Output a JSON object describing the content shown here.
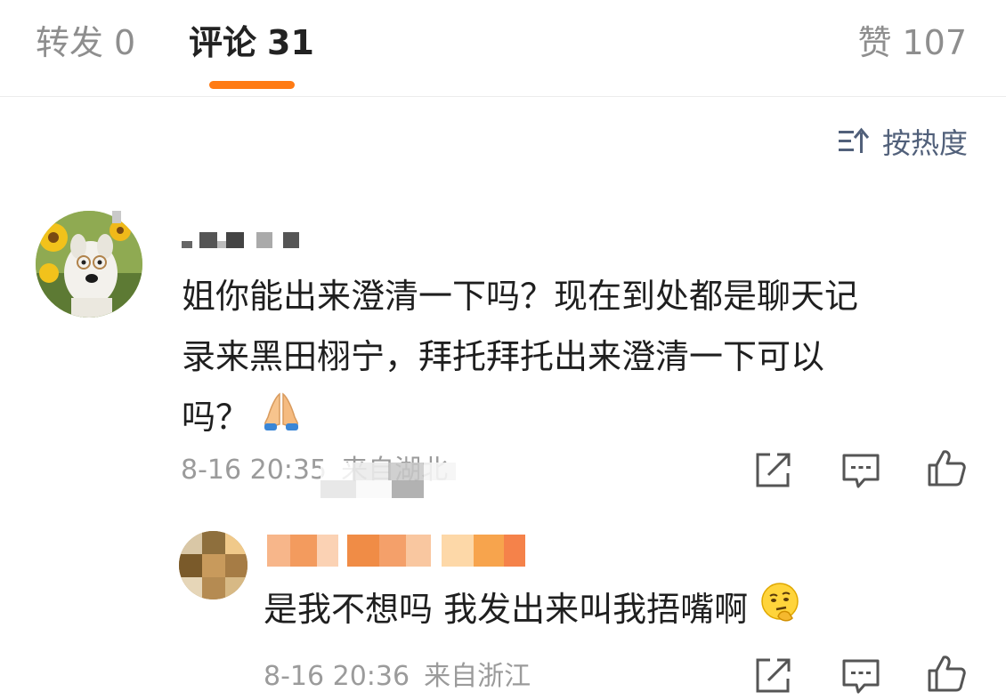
{
  "tabs": {
    "repost": {
      "label": "转发",
      "count": "0"
    },
    "comments": {
      "label": "评论",
      "count": "31"
    },
    "likes": {
      "label": "赞",
      "count": "107"
    }
  },
  "sort": {
    "label": "按热度",
    "icon": "sort-icon"
  },
  "colors": {
    "accent": "#ff7b14",
    "muted_text": "#9b9b9b",
    "sort_text": "#51607a"
  },
  "comment": {
    "avatar": "avatar-dog-sunflowers",
    "username_hidden": true,
    "lines": [
      "姐你能出来澄清一下吗？现在到处都是聊天记",
      "录来黑田栩宁，拜托拜托出来澄清一下可以",
      "吗？"
    ],
    "emoji": "folded-hands-emoji",
    "time": "8-16 20:35",
    "location": "来自湖北",
    "actions": [
      "share-icon",
      "comment-icon",
      "like-icon"
    ]
  },
  "reply": {
    "avatar": "avatar-blurred",
    "username_hidden": true,
    "text": "是我不想吗 我发出来叫我捂嘴啊",
    "emoji": "thinking-face-emoji",
    "time": "8-16 20:36",
    "location": "来自浙江",
    "actions": [
      "share-icon",
      "comment-icon",
      "like-icon"
    ]
  }
}
